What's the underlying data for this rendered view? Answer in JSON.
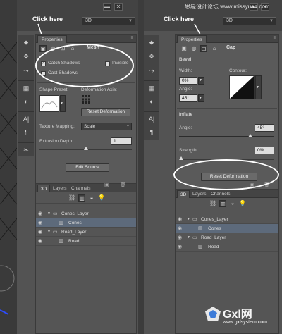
{
  "watermark": "思缘设计论坛 www.missyuan.com",
  "callouts": {
    "left": "Click here",
    "right": "Click here"
  },
  "panel_select": {
    "left": "3D",
    "right": "3D"
  },
  "left_panel": {
    "tab": "Properties",
    "header_title": "Mesh",
    "catch_shadows_label": "Catch Shadows",
    "catch_shadows_checked": true,
    "cast_shadows_label": "Cast Shadows",
    "cast_shadows_checked": false,
    "invisible_label": "Invisible",
    "shape_preset_label": "Shape Preset:",
    "deformation_axis_label": "Deformation Axis:",
    "reset_deformation_label": "Reset Deformation",
    "texture_mapping_label": "Texture Mapping:",
    "texture_mapping_value": "Scale",
    "extrusion_depth_label": "Extrusion Depth:",
    "extrusion_depth_value": "1",
    "extrusion_depth_level": 0.5,
    "edit_source_label": "Edit Source"
  },
  "right_panel": {
    "tab": "Properties",
    "header_title": "Cap",
    "bevel_label": "Bevel",
    "width_label": "Width:",
    "width_value": "0%",
    "contour_label": "Contour:",
    "angle_label": "Angle:",
    "angle_value": "45°",
    "inflate_label": "Inflate",
    "inflate_angle_label": "Angle:",
    "inflate_angle_value": "45°",
    "inflate_angle_level": 0.75,
    "strength_label": "Strength:",
    "strength_value": "0%",
    "strength_level": 0.02,
    "reset_deformation_label": "Reset Deformation"
  },
  "layers_panel": {
    "tabs": [
      "3D",
      "Layers",
      "Channels"
    ],
    "active_tab": "3D",
    "rows": [
      {
        "name": "Cones_Layer",
        "type": "group",
        "selected": false
      },
      {
        "name": "Cones",
        "type": "mesh",
        "selected": true
      },
      {
        "name": "Road_Layer",
        "type": "group",
        "selected": false
      },
      {
        "name": "Road",
        "type": "mesh",
        "selected": false
      }
    ]
  },
  "brand": {
    "name": "Gxl网",
    "url": "www.gxlsystem.com"
  },
  "colors": {
    "panel": "#535353",
    "dark": "#434343",
    "selected_row": "#5d6a7b",
    "highlight": "#ffffff"
  }
}
